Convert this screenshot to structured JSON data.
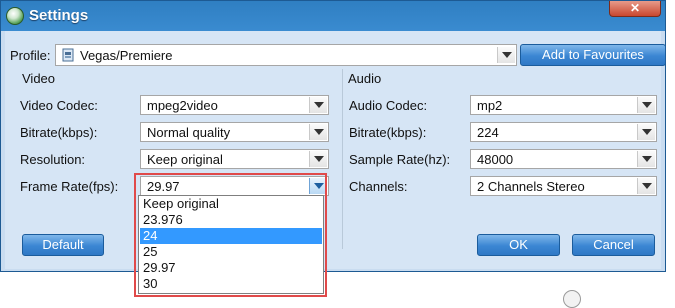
{
  "window": {
    "title": "Settings",
    "close_symbol": "✕"
  },
  "profile": {
    "label": "Profile:",
    "value": "Vegas/Premiere",
    "add_button": "Add to Favourites"
  },
  "video": {
    "section_label": "Video",
    "codec": {
      "label": "Video Codec:",
      "value": "mpeg2video"
    },
    "bitrate": {
      "label": "Bitrate(kbps):",
      "value": "Normal quality"
    },
    "resolution": {
      "label": "Resolution:",
      "value": "Keep original"
    },
    "frame_rate": {
      "label": "Frame Rate(fps):",
      "value": "29.97"
    }
  },
  "audio": {
    "section_label": "Audio",
    "codec": {
      "label": "Audio Codec:",
      "value": "mp2"
    },
    "bitrate": {
      "label": "Bitrate(kbps):",
      "value": "224"
    },
    "sample_rate": {
      "label": "Sample Rate(hz):",
      "value": "48000"
    },
    "channels": {
      "label": "Channels:",
      "value": "2 Channels Stereo"
    }
  },
  "frame_rate_options": [
    "Keep original",
    "23.976",
    "24",
    "25",
    "29.97",
    "30"
  ],
  "frame_rate_highlighted": "24",
  "buttons": {
    "default": "Default",
    "ok": "OK",
    "cancel": "Cancel"
  },
  "colors": {
    "accent": "#3399ff",
    "titlebar": "#2f7fc2",
    "highlight_border": "#e04a4a"
  },
  "icons": {
    "app": "app-logo-icon",
    "profile": "video-clip-icon",
    "dropdown": "chevron-down-icon"
  }
}
